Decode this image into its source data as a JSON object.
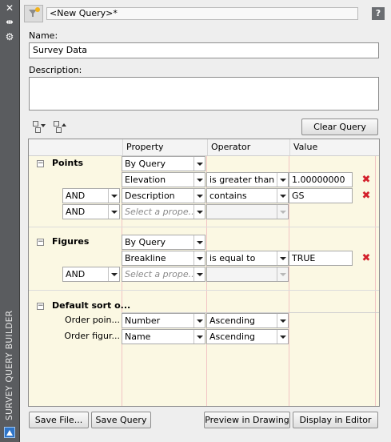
{
  "rail": {
    "close_glyph": "✕",
    "pin_glyph": "⇹",
    "settings_glyph": "⚙",
    "title": "SURVEY QUERY BUILDER"
  },
  "query": {
    "title": "<New Query>*",
    "help": "?"
  },
  "form": {
    "name_label": "Name:",
    "name_value": "Survey Data",
    "description_label": "Description:",
    "description_value": ""
  },
  "toolbar": {
    "clear_query": "Clear Query"
  },
  "grid": {
    "columns": [
      "Property",
      "Operator",
      "Value"
    ],
    "groups": [
      {
        "name": "Points",
        "rows": [
          {
            "logic": "",
            "property": "By Query",
            "operator": "",
            "value": ""
          },
          {
            "logic": "",
            "property": "Elevation",
            "operator": "is greater than",
            "value": "1.00000000"
          },
          {
            "logic": "AND",
            "property": "Description",
            "operator": "contains",
            "value": "GS"
          },
          {
            "logic": "AND",
            "property": "Select a prope...",
            "operator": "",
            "value": ""
          }
        ]
      },
      {
        "name": "Figures",
        "rows": [
          {
            "logic": "",
            "property": "By Query",
            "operator": "",
            "value": ""
          },
          {
            "logic": "",
            "property": "Breakline",
            "operator": "is equal to",
            "value": "TRUE"
          },
          {
            "logic": "AND",
            "property": "Select a prope...",
            "operator": "",
            "value": ""
          }
        ]
      },
      {
        "name": "Default sort o...",
        "rows": [
          {
            "label": "Order poin...",
            "property": "Number",
            "operator": "Ascending"
          },
          {
            "label": "Order figur...",
            "property": "Name",
            "operator": "Ascending"
          }
        ]
      }
    ],
    "delete_glyph": "✖"
  },
  "footer": {
    "save_file": "Save File...",
    "save_query": "Save Query",
    "preview": "Preview in Drawing",
    "display": "Display in Editor"
  },
  "colors": {
    "grid_background": "#fbf8e3",
    "delete_red": "#d3202b",
    "rail": "#5a5c5f"
  }
}
